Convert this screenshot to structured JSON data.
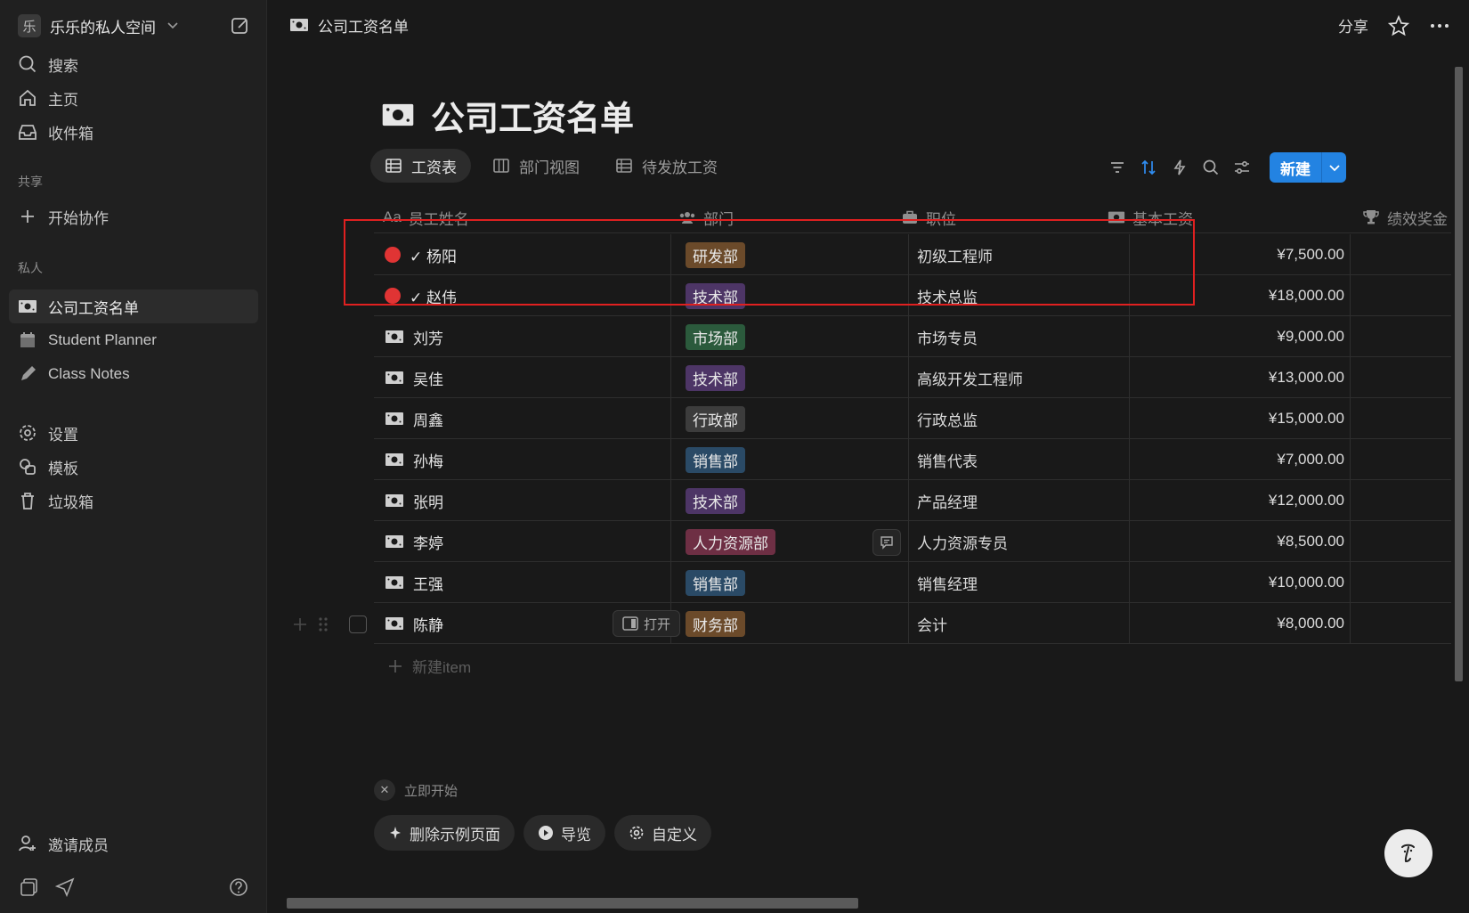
{
  "sidebar": {
    "workspace_avatar": "乐",
    "workspace_name": "乐乐的私人空间",
    "nav": {
      "search": "搜索",
      "home": "主页",
      "inbox": "收件箱"
    },
    "shared_label": "共享",
    "start_collab": "开始协作",
    "private_label": "私人",
    "pages": [
      {
        "label": "公司工资名单",
        "icon": "banknote-icon"
      },
      {
        "label": "Student Planner",
        "icon": "calendar-icon"
      },
      {
        "label": "Class Notes",
        "icon": "pencil-icon"
      }
    ],
    "settings": "设置",
    "templates": "模板",
    "trash": "垃圾箱",
    "invite": "邀请成员"
  },
  "topbar": {
    "title": "公司工资名单",
    "share": "分享"
  },
  "page": {
    "title": "公司工资名单",
    "tabs": [
      {
        "label": "工资表",
        "active": true
      },
      {
        "label": "部门视图",
        "active": false
      },
      {
        "label": "待发放工资",
        "active": false
      }
    ],
    "new_button": "新建"
  },
  "table": {
    "columns": [
      "员工姓名",
      "部门",
      "职位",
      "基本工资",
      "绩效奖金"
    ],
    "rows": [
      {
        "name": "✓ 杨阳",
        "dept": "研发部",
        "position": "初级工程师",
        "salary": "¥7,500.00",
        "marker": "red-dot"
      },
      {
        "name": "✓ 赵伟",
        "dept": "技术部",
        "position": "技术总监",
        "salary": "¥18,000.00",
        "marker": "red-dot"
      },
      {
        "name": "刘芳",
        "dept": "市场部",
        "position": "市场专员",
        "salary": "¥9,000.00",
        "marker": "banknote-icon"
      },
      {
        "name": "吴佳",
        "dept": "技术部",
        "position": "高级开发工程师",
        "salary": "¥13,000.00",
        "marker": "banknote-icon"
      },
      {
        "name": "周鑫",
        "dept": "行政部",
        "position": "行政总监",
        "salary": "¥15,000.00",
        "marker": "banknote-icon"
      },
      {
        "name": "孙梅",
        "dept": "销售部",
        "position": "销售代表",
        "salary": "¥7,000.00",
        "marker": "banknote-icon"
      },
      {
        "name": "张明",
        "dept": "技术部",
        "position": "产品经理",
        "salary": "¥12,000.00",
        "marker": "banknote-icon"
      },
      {
        "name": "李婷",
        "dept": "人力资源部",
        "position": "人力资源专员",
        "salary": "¥8,500.00",
        "marker": "banknote-icon"
      },
      {
        "name": "王强",
        "dept": "销售部",
        "position": "销售经理",
        "salary": "¥10,000.00",
        "marker": "banknote-icon"
      },
      {
        "name": "陈静",
        "dept": "财务部",
        "position": "会计",
        "salary": "¥8,000.00",
        "marker": "banknote-icon"
      }
    ],
    "dept_colors": {
      "研发部": "#6b4a2a",
      "技术部": "#4d3566",
      "市场部": "#2b5a3c",
      "行政部": "#3c3c3c",
      "销售部": "#2a4a66",
      "人力资源部": "#6e2f44",
      "财务部": "#6b4a2a"
    },
    "open_label": "打开",
    "new_item": "新建item"
  },
  "bottom": {
    "get_started": "立即开始",
    "actions": [
      "删除示例页面",
      "导览",
      "自定义"
    ]
  },
  "colors": {
    "accent": "#2383e2",
    "highlight": "#e02020"
  }
}
